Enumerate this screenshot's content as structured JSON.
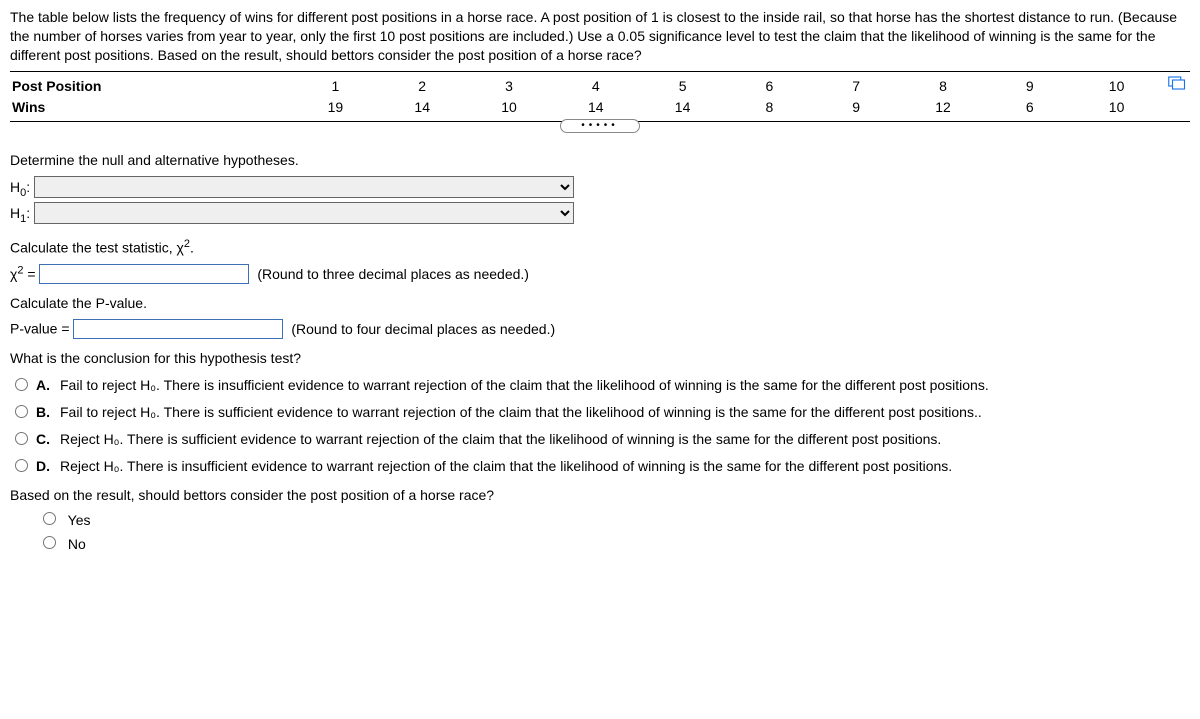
{
  "problem": "The table below lists the frequency of wins for different post positions in a horse race. A post position of 1 is closest to the inside rail, so that horse has the shortest distance to run. (Because the number of horses varies from year to year, only the first 10 post positions are included.) Use a 0.05 significance level to test the claim that the likelihood of winning is the same for the different post positions. Based on the result, should bettors consider the post position of a horse race?",
  "table": {
    "row1_label": "Post Position",
    "row2_label": "Wins",
    "positions": [
      "1",
      "2",
      "3",
      "4",
      "5",
      "6",
      "7",
      "8",
      "9",
      "10"
    ],
    "wins": [
      "19",
      "14",
      "10",
      "14",
      "14",
      "8",
      "9",
      "12",
      "6",
      "10"
    ]
  },
  "sections": {
    "determine": "Determine the null and alternative hypotheses.",
    "h0_label": "H",
    "h0_sub": "0",
    "h1_label": "H",
    "h1_sub": "1",
    "colon": ":",
    "calc_stat": "Calculate the test statistic, χ",
    "calc_stat_sup": "2",
    "calc_stat_period": ".",
    "chi_label": "χ",
    "chi_sup": "2",
    "equals": " =",
    "stat_hint": "(Round to three decimal places as needed.)",
    "calc_p": "Calculate the P-value.",
    "p_label": "P-value =",
    "p_hint": "(Round to four decimal places as needed.)",
    "conclusion_q": "What is the conclusion for this hypothesis test?",
    "followup_q": "Based on the result, should bettors consider the post position of a horse race?",
    "yes": "Yes",
    "no": "No"
  },
  "options": {
    "A": {
      "label": "A.",
      "text": "Fail to reject H₀. There is insufficient evidence to warrant rejection of the claim that the likelihood of winning is the same for the different post positions."
    },
    "B": {
      "label": "B.",
      "text": "Fail to reject H₀. There is sufficient evidence to warrant rejection of the claim that the likelihood of winning is the same for the different post positions.."
    },
    "C": {
      "label": "C.",
      "text": "Reject H₀. There is sufficient evidence to warrant rejection of the claim that the likelihood of winning is the same for the different post positions."
    },
    "D": {
      "label": "D.",
      "text": "Reject H₀. There is insufficient evidence to warrant rejection of the claim that the likelihood of winning is the same for the different post positions."
    }
  }
}
